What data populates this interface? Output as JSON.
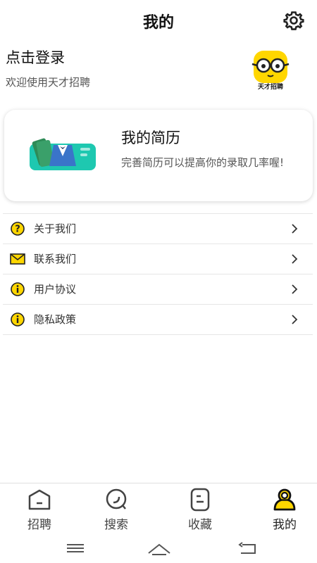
{
  "header": {
    "title": "我的",
    "settings_icon": "gear-icon"
  },
  "login": {
    "title": "点击登录",
    "subtitle": "欢迎使用天才招聘",
    "logo_text": "天才招聘"
  },
  "resume_card": {
    "title": "我的简历",
    "description": "完善简历可以提高你的录取几率喔!"
  },
  "menu": {
    "items": [
      {
        "label": "关于我们",
        "icon": "question-icon"
      },
      {
        "label": "联系我们",
        "icon": "mail-icon"
      },
      {
        "label": "用户协议",
        "icon": "info-icon"
      },
      {
        "label": "隐私政策",
        "icon": "info-icon"
      }
    ]
  },
  "bottom_nav": {
    "items": [
      {
        "label": "招聘",
        "icon": "recruit-icon",
        "active": false
      },
      {
        "label": "搜索",
        "icon": "search-icon",
        "active": false
      },
      {
        "label": "收藏",
        "icon": "favorites-icon",
        "active": false
      },
      {
        "label": "我的",
        "icon": "profile-icon",
        "active": true
      }
    ]
  },
  "colors": {
    "accent": "#FFD600",
    "text": "#222222",
    "muted": "#555555"
  }
}
